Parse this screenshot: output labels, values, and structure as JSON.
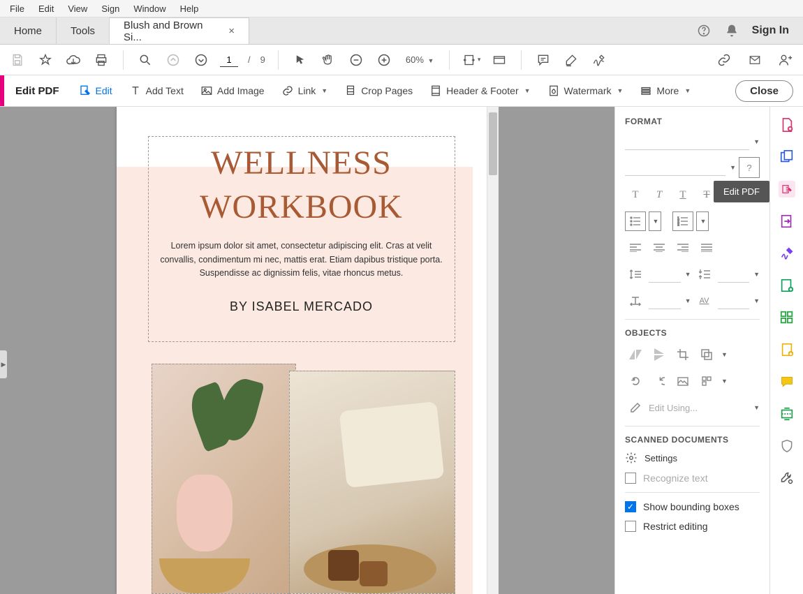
{
  "menubar": [
    "File",
    "Edit",
    "View",
    "Sign",
    "Window",
    "Help"
  ],
  "tabs": {
    "home": "Home",
    "tools": "Tools",
    "doc": "Blush and Brown Si..."
  },
  "top_right": {
    "signin": "Sign In"
  },
  "toolbar": {
    "page_current": "1",
    "page_sep": "/",
    "page_total": "9",
    "zoom": "60%"
  },
  "edit_toolbar": {
    "title": "Edit PDF",
    "tools": {
      "edit": "Edit",
      "add_text": "Add Text",
      "add_image": "Add Image",
      "link": "Link",
      "crop": "Crop Pages",
      "header_footer": "Header & Footer",
      "watermark": "Watermark",
      "more": "More"
    },
    "close": "Close"
  },
  "document": {
    "title_line1": "WELLNESS",
    "title_line2": "WORKBOOK",
    "body": "Lorem ipsum dolor sit amet, consectetur adipiscing elit. Cras at velit convallis, condimentum mi nec, mattis erat. Etiam dapibus tristique porta. Suspendisse ac dignissim felis, vitae rhoncus metus.",
    "author": "BY ISABEL MERCADO"
  },
  "format_panel": {
    "format_heading": "FORMAT",
    "objects_heading": "OBJECTS",
    "edit_using": "Edit Using...",
    "scanned_heading": "SCANNED DOCUMENTS",
    "settings": "Settings",
    "recognize": "Recognize text",
    "show_bounding": "Show bounding boxes",
    "restrict": "Restrict editing"
  },
  "tooltip": "Edit PDF"
}
